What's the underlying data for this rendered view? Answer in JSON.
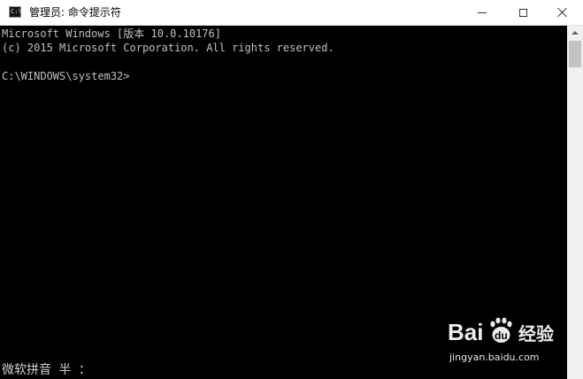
{
  "window": {
    "title": "管理员: 命令提示符",
    "icon": "cmd-icon",
    "icon_text": "C:\\"
  },
  "console": {
    "lines": [
      "Microsoft Windows [版本 10.0.10176]",
      "(c) 2015 Microsoft Corporation. All rights reserved.",
      "C:\\WINDOWS\\system32>"
    ],
    "ime_status": "微软拼音 半 ："
  },
  "watermark": {
    "logo_text": "Bai du 经验",
    "url": "jingyan.baidu.com"
  },
  "colors": {
    "console_bg": "#000000",
    "console_text": "#c0c0c0",
    "titlebar_bg": "#ffffff",
    "scrollbar_bg": "#f0f0f0"
  }
}
